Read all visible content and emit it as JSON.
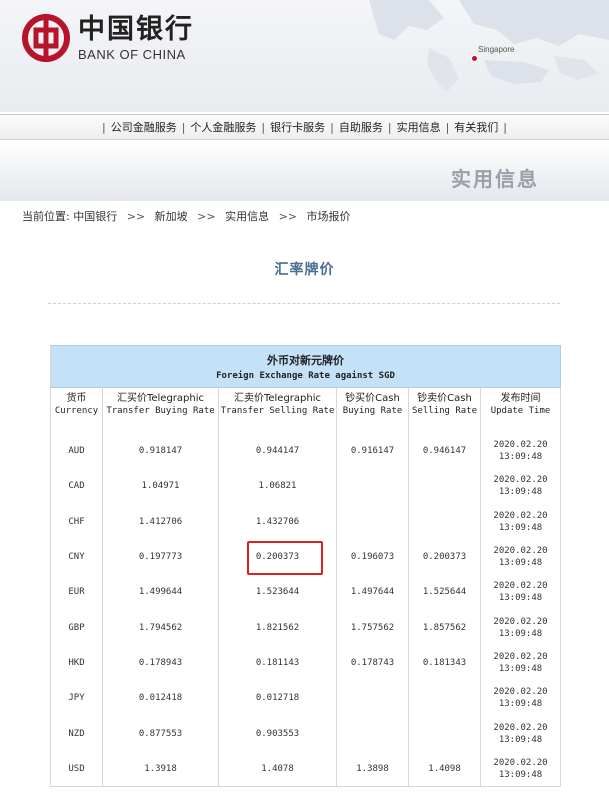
{
  "brand": {
    "name_cn": "中国银行",
    "name_en": "BANK OF CHINA",
    "map_label": "Singapore",
    "accent_color": "#b7132a"
  },
  "nav": {
    "items": [
      "公司金融服务",
      "个人金融服务",
      "银行卡服务",
      "自助服务",
      "实用信息",
      "有关我们"
    ]
  },
  "banner": {
    "title": "实用信息"
  },
  "breadcrumb": {
    "label": "当前位置:",
    "items": [
      "中国银行",
      "新加坡",
      "实用信息",
      "市场报价"
    ],
    "separator": ">>"
  },
  "page_title": "汇率牌价",
  "table": {
    "caption_cn": "外币对新元牌价",
    "caption_en": "Foreign Exchange Rate against SGD",
    "headers": [
      {
        "cn": "货币",
        "en": "Currency"
      },
      {
        "cn": "汇买价Telegraphic",
        "en": "Transfer Buying Rate"
      },
      {
        "cn": "汇卖价Telegraphic",
        "en": "Transfer Selling Rate"
      },
      {
        "cn": "钞买价Cash",
        "en": "Buying Rate"
      },
      {
        "cn": "钞卖价Cash",
        "en": "Selling Rate"
      },
      {
        "cn": "发布时间",
        "en": "Update Time"
      }
    ],
    "rows": [
      {
        "currency": "AUD",
        "tt_buy": "0.918147",
        "tt_sell": "0.944147",
        "cash_buy": "0.916147",
        "cash_sell": "0.946147",
        "date": "2020.02.20",
        "time": "13:09:48"
      },
      {
        "currency": "CAD",
        "tt_buy": "1.04971",
        "tt_sell": "1.06821",
        "cash_buy": "",
        "cash_sell": "",
        "date": "2020.02.20",
        "time": "13:09:48"
      },
      {
        "currency": "CHF",
        "tt_buy": "1.412706",
        "tt_sell": "1.432706",
        "cash_buy": "",
        "cash_sell": "",
        "date": "2020.02.20",
        "time": "13:09:48"
      },
      {
        "currency": "CNY",
        "tt_buy": "0.197773",
        "tt_sell": "0.200373",
        "cash_buy": "0.196073",
        "cash_sell": "0.200373",
        "date": "2020.02.20",
        "time": "13:09:48"
      },
      {
        "currency": "EUR",
        "tt_buy": "1.499644",
        "tt_sell": "1.523644",
        "cash_buy": "1.497644",
        "cash_sell": "1.525644",
        "date": "2020.02.20",
        "time": "13:09:48"
      },
      {
        "currency": "GBP",
        "tt_buy": "1.794562",
        "tt_sell": "1.821562",
        "cash_buy": "1.757562",
        "cash_sell": "1.857562",
        "date": "2020.02.20",
        "time": "13:09:48"
      },
      {
        "currency": "HKD",
        "tt_buy": "0.178943",
        "tt_sell": "0.181143",
        "cash_buy": "0.178743",
        "cash_sell": "0.181343",
        "date": "2020.02.20",
        "time": "13:09:48"
      },
      {
        "currency": "JPY",
        "tt_buy": "0.012418",
        "tt_sell": "0.012718",
        "cash_buy": "",
        "cash_sell": "",
        "date": "2020.02.20",
        "time": "13:09:48"
      },
      {
        "currency": "NZD",
        "tt_buy": "0.877553",
        "tt_sell": "0.903553",
        "cash_buy": "",
        "cash_sell": "",
        "date": "2020.02.20",
        "time": "13:09:48"
      },
      {
        "currency": "USD",
        "tt_buy": "1.3918",
        "tt_sell": "1.4078",
        "cash_buy": "1.3898",
        "cash_sell": "1.4098",
        "date": "2020.02.20",
        "time": "13:09:48"
      }
    ],
    "highlight_color": "#e02020"
  }
}
